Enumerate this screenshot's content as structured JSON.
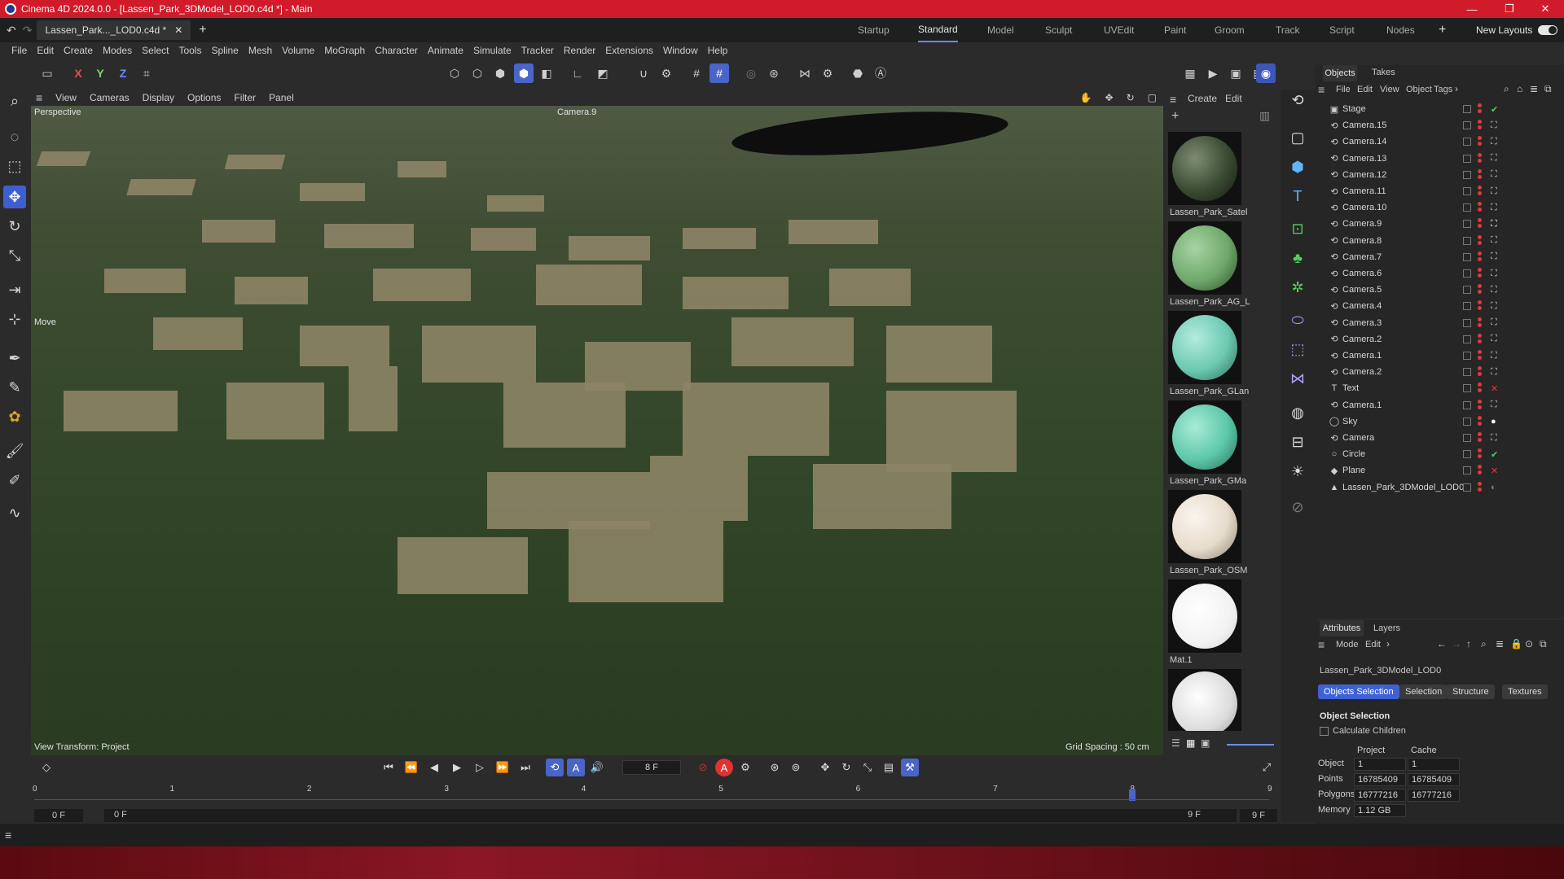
{
  "window": {
    "title": "Cinema 4D 2024.0.0 - [Lassen_Park_3DModel_LOD0.c4d *] - Main",
    "controls": [
      "—",
      "❐",
      "✕"
    ]
  },
  "tabs": {
    "doc_tab": "Lassen_Park..._LOD0.c4d *",
    "layouts": [
      "Startup",
      "Standard",
      "Model",
      "Sculpt",
      "UVEdit",
      "Paint",
      "Groom",
      "Track",
      "Script",
      "Nodes"
    ],
    "active_layout": "Standard",
    "new_layouts": "New Layouts"
  },
  "menu": [
    "File",
    "Edit",
    "Create",
    "Modes",
    "Select",
    "Tools",
    "Spline",
    "Mesh",
    "Volume",
    "MoGraph",
    "Character",
    "Animate",
    "Simulate",
    "Tracker",
    "Render",
    "Extensions",
    "Window",
    "Help"
  ],
  "axis_buttons": [
    "X",
    "Y",
    "Z"
  ],
  "viewport": {
    "menu": [
      "View",
      "Cameras",
      "Display",
      "Options",
      "Filter",
      "Panel"
    ],
    "projection": "Perspective",
    "camera": "Camera.9",
    "tool_label": "Move",
    "view_transform": "View Transform: Project",
    "grid_spacing": "Grid Spacing : 50 cm"
  },
  "materials": {
    "menu": [
      "Create",
      "Edit"
    ],
    "items": [
      {
        "label": "Lassen_Park_Satel",
        "color": "#3a4a32"
      },
      {
        "label": "Lassen_Park_AG_L",
        "color": "#6fa86a"
      },
      {
        "label": "Lassen_Park_GLan",
        "color": "#6cc9b1"
      },
      {
        "label": "Lassen_Park_GMa",
        "color": "#5cc7a8"
      },
      {
        "label": "Lassen_Park_OSM",
        "color": "#e6dccb"
      },
      {
        "label": "Mat.1",
        "color": "#ffffff"
      }
    ]
  },
  "objects": {
    "tabs": [
      "Objects",
      "Takes"
    ],
    "menu": [
      "File",
      "Edit",
      "View",
      "Object",
      "Tags"
    ],
    "rows": [
      {
        "name": "Stage",
        "icon": "stage-icon",
        "tag": "check"
      },
      {
        "name": "Camera.15",
        "icon": "camera-icon",
        "tag": "target"
      },
      {
        "name": "Camera.14",
        "icon": "camera-icon",
        "tag": "target"
      },
      {
        "name": "Camera.13",
        "icon": "camera-icon",
        "tag": "target"
      },
      {
        "name": "Camera.12",
        "icon": "camera-icon",
        "tag": "target"
      },
      {
        "name": "Camera.11",
        "icon": "camera-icon",
        "tag": "target"
      },
      {
        "name": "Camera.10",
        "icon": "camera-icon",
        "tag": "target"
      },
      {
        "name": "Camera.9",
        "icon": "camera-icon",
        "tag": "target-active"
      },
      {
        "name": "Camera.8",
        "icon": "camera-icon",
        "tag": "target"
      },
      {
        "name": "Camera.7",
        "icon": "camera-icon",
        "tag": "target"
      },
      {
        "name": "Camera.6",
        "icon": "camera-icon",
        "tag": "target"
      },
      {
        "name": "Camera.5",
        "icon": "camera-icon",
        "tag": "target"
      },
      {
        "name": "Camera.4",
        "icon": "camera-icon",
        "tag": "target"
      },
      {
        "name": "Camera.3",
        "icon": "camera-icon",
        "tag": "target"
      },
      {
        "name": "Camera.2",
        "icon": "camera-icon",
        "tag": "target"
      },
      {
        "name": "Camera.1",
        "icon": "camera-icon",
        "tag": "target"
      },
      {
        "name": "Camera.2",
        "icon": "camera-icon",
        "tag": "target"
      },
      {
        "name": "Text",
        "icon": "text-icon",
        "tag": "cross"
      },
      {
        "name": "Camera.1",
        "icon": "camera-icon",
        "tag": "target"
      },
      {
        "name": "Sky",
        "icon": "sky-icon",
        "tag": "white-ball"
      },
      {
        "name": "Camera",
        "icon": "camera-icon",
        "tag": "target"
      },
      {
        "name": "Circle",
        "icon": "circle-icon",
        "tag": "check"
      },
      {
        "name": "Plane",
        "icon": "plane-icon",
        "tag": "cross"
      },
      {
        "name": "Lassen_Park_3DModel_LOD0",
        "icon": "polygon-icon",
        "tag": "material"
      }
    ]
  },
  "attributes": {
    "tabs": [
      "Attributes",
      "Layers"
    ],
    "menu": [
      "Mode",
      "Edit"
    ],
    "object_name": "Lassen_Park_3DModel_LOD0",
    "sub_tabs": [
      "Objects Selection",
      "Selection",
      "Structure",
      "Textures"
    ],
    "section": "Object Selection",
    "calc_children": "Calculate Children",
    "col_project": "Project",
    "col_cache": "Cache",
    "rows": [
      {
        "label": "Object",
        "project": "1",
        "cache": "1"
      },
      {
        "label": "Points",
        "project": "16785409",
        "cache": "16785409"
      },
      {
        "label": "Polygons",
        "project": "16777216",
        "cache": "16777216"
      },
      {
        "label": "Memory",
        "project": "1.12 GB",
        "cache": ""
      }
    ]
  },
  "timeline": {
    "current_frame": "8 F",
    "start": "0 F",
    "start2": "0 F",
    "end": "9 F",
    "end2": "9 F",
    "ticks": [
      "0",
      "1",
      "2",
      "3",
      "4",
      "5",
      "6",
      "7",
      "8",
      "9"
    ],
    "playhead_frame": 8
  },
  "colors": {
    "title_bar": "#d11a2a",
    "accent": "#3e62d6",
    "panel": "#2b2b2b"
  }
}
